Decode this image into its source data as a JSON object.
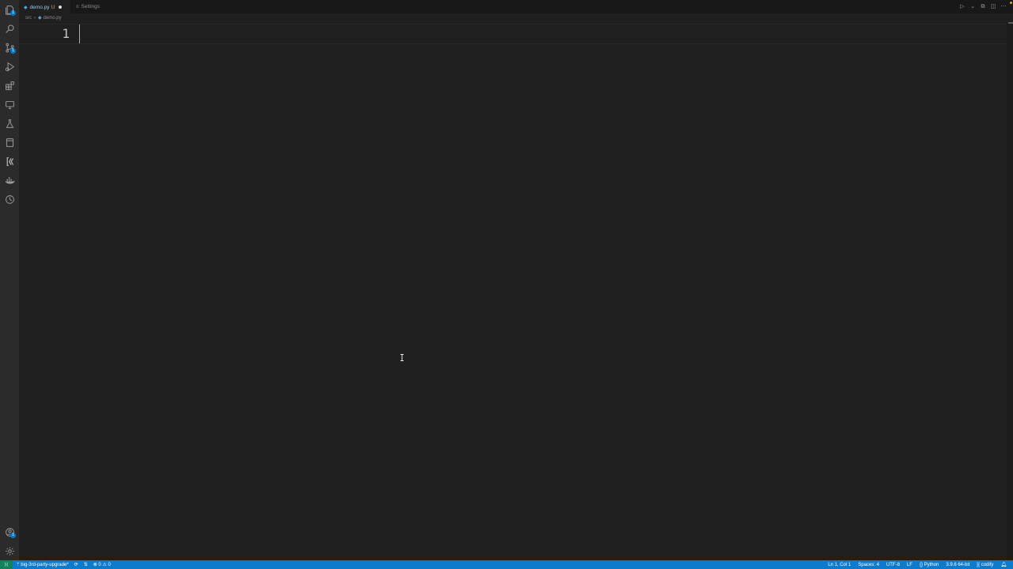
{
  "activity_bar": {
    "items": [
      {
        "name": "explorer-icon",
        "badge": "1"
      },
      {
        "name": "search-icon",
        "badge": ""
      },
      {
        "name": "source-control-icon",
        "badge": "1"
      },
      {
        "name": "run-debug-icon",
        "badge": ""
      },
      {
        "name": "extensions-icon",
        "badge": ""
      },
      {
        "name": "remote-explorer-icon",
        "badge": ""
      },
      {
        "name": "testing-icon",
        "badge": ""
      },
      {
        "name": "notebook-icon",
        "badge": ""
      },
      {
        "name": "codify-icon",
        "badge": ""
      },
      {
        "name": "docker-icon",
        "badge": ""
      },
      {
        "name": "timeline-icon",
        "badge": ""
      }
    ],
    "accounts_badge": "1"
  },
  "tabs": [
    {
      "label": "demo.py",
      "status": "U",
      "active": true
    },
    {
      "label": "Settings",
      "active": false
    }
  ],
  "breadcrumb": {
    "folder": "src",
    "file": "demo.py"
  },
  "editor": {
    "line_number": "1"
  },
  "status_bar": {
    "branch": "big-3rd-party-upgrade*",
    "errors": "0",
    "warnings": "0",
    "position": "Ln 1, Col 1",
    "spaces": "Spaces: 4",
    "encoding": "UTF-8",
    "eol": "LF",
    "language": "Python",
    "interpreter": "3.9.6 64-bit",
    "extension": "codify"
  },
  "colors": {
    "status_bar": "#0e7acc",
    "remote": "#16825d",
    "editor_bg": "#1f1f1f",
    "activity_bar": "#2b2b2b"
  }
}
